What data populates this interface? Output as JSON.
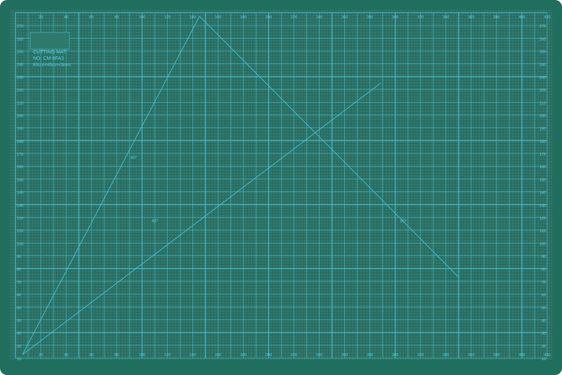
{
  "mat": {
    "colors": {
      "mat_green": "#1f6e5e",
      "border_green": "#1b6a59",
      "grid_cyan": "#46c7df",
      "text_cyan": "#5fd0e6"
    },
    "label": {
      "line1": "CUTTING MAT",
      "line2": "NO. CM-9FA3",
      "line3": "60cm×45cm×3mm"
    },
    "ticks_top": [
      "10",
      "20",
      "30",
      "40",
      "50",
      "60",
      "70",
      "80",
      "90",
      "100",
      "110",
      "120",
      "130",
      "140",
      "150",
      "160",
      "170",
      "180",
      "190",
      "200",
      "210",
      "220",
      "230",
      "240",
      "250",
      "260",
      "270",
      "280",
      "290",
      "300",
      "310",
      "320",
      "330",
      "340",
      "350",
      "360",
      "370",
      "380",
      "390",
      "400",
      "410",
      "420"
    ],
    "ticks_bottom": [
      "10",
      "20",
      "30",
      "40",
      "50",
      "60",
      "70",
      "80",
      "90",
      "100",
      "110",
      "120",
      "130",
      "140",
      "150",
      "160",
      "170",
      "180",
      "190",
      "200",
      "210",
      "220",
      "230",
      "240",
      "250",
      "260",
      "270",
      "280",
      "290",
      "300",
      "310",
      "320",
      "330",
      "340",
      "350",
      "360",
      "370",
      "380",
      "390",
      "400",
      "410",
      "420"
    ],
    "ticks_left": [
      "270",
      "260",
      "250",
      "240",
      "230",
      "220",
      "210",
      "200",
      "190",
      "180",
      "170",
      "160",
      "150",
      "140",
      "130",
      "120",
      "110",
      "100",
      "90",
      "80",
      "70",
      "60",
      "50",
      "40",
      "30",
      "20",
      "10"
    ],
    "ticks_right": [
      "270",
      "260",
      "250",
      "240",
      "230",
      "220",
      "210",
      "200",
      "190",
      "180",
      "170",
      "160",
      "150",
      "140",
      "130",
      "120",
      "110",
      "100",
      "90",
      "80",
      "70",
      "60",
      "50",
      "40",
      "30",
      "20",
      "10"
    ],
    "angle_labels": [
      "60°",
      "45°",
      "60°"
    ]
  }
}
